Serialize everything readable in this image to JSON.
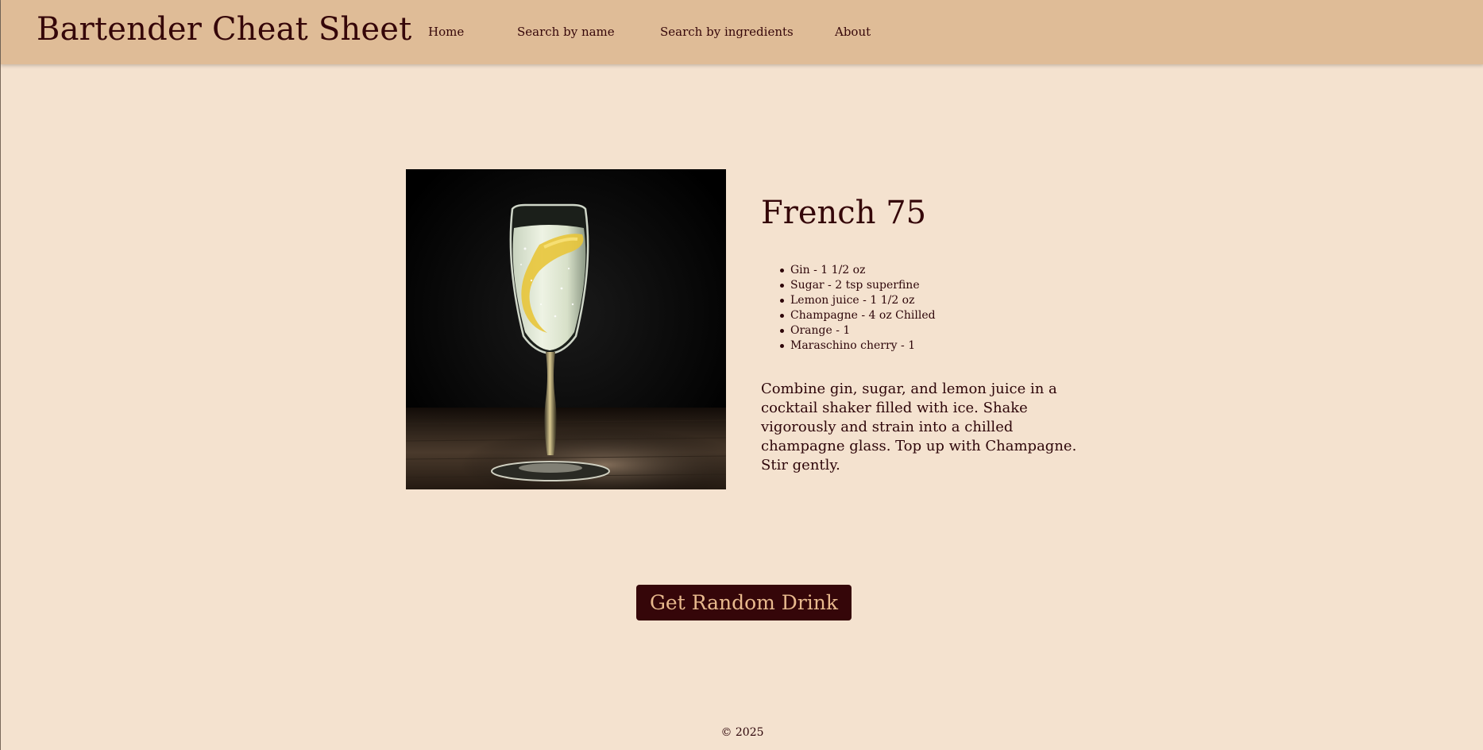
{
  "header": {
    "brand": "Bartender Cheat Sheet",
    "nav": {
      "home": "Home",
      "search_by_name": "Search by name",
      "search_by_ingredients": "Search by ingredients",
      "about": "About"
    }
  },
  "drink": {
    "name": "French 75",
    "image_icon": "champagne-glass-photo",
    "ingredients": [
      "Gin - 1 1/2 oz",
      "Sugar - 2 tsp superfine",
      "Lemon juice - 1 1/2 oz",
      "Champagne - 4 oz Chilled",
      "Orange - 1",
      "Maraschino cherry - 1"
    ],
    "instructions": "Combine gin, sugar, and lemon juice in a cocktail shaker filled with ice. Shake vigorously and strain into a chilled champagne glass. Top up with Champagne. Stir gently."
  },
  "actions": {
    "random_button": "Get Random Drink"
  },
  "footer": {
    "copyright": "© 2025"
  },
  "colors": {
    "background": "#f4e2cf",
    "navbar": "#dfbc97",
    "text": "#350609",
    "button_bg": "#350609",
    "button_text": "#e8b98d"
  }
}
